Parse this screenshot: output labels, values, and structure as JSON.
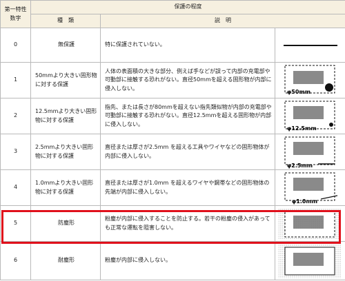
{
  "header": {
    "first_digit": "第一特性\n数字",
    "protection_degree": "保護の程度",
    "type": "種　類",
    "description": "説　明"
  },
  "rows": [
    {
      "digit": "0",
      "type": "無保護",
      "description": "特に保護されていない。",
      "figure": "line"
    },
    {
      "digit": "1",
      "type": "50mmより大きい固形物に対する保護",
      "description": "人体の表面積の大きな部分、例えば手などが誤って内部の充電部や可動部に接触する恐れがない。直径50mmを超える固形物が内部に侵入しない。",
      "figure": "50mm"
    },
    {
      "digit": "2",
      "type": "12.5mmより大きい固形物に対する保護",
      "description": "指先、または長さが80mmを超えない指先類似物が内部の充電部や可動部に接触する恐れがない。直径12.5mmを超える固形物が内部に侵入しない。",
      "figure": "12.5mm"
    },
    {
      "digit": "3",
      "type": "2.5mmより大きい固形物に対する保護",
      "description": "直径または厚さが2.5mm を超える工具やワイヤなどの固形物体が内部に侵入しない。",
      "figure": "2.5mm"
    },
    {
      "digit": "4",
      "type": "1.0mmより大きい固形物に対する保護",
      "description": "直径または厚さが1.0mm を超えるワイヤや鋼帯などの固形物体の先端が内部に侵入しない。",
      "figure": "1.0mm"
    },
    {
      "digit": "5",
      "type": "防塵形",
      "description": "粉塵が内部に侵入することを防止する。若干の粉塵の侵入があっても正常な運転を阻害しない。",
      "figure": "dust"
    },
    {
      "digit": "6",
      "type": "耐塵形",
      "description": "粉塵が内部に侵入しない。",
      "figure": "dusttight"
    }
  ],
  "figure_labels": {
    "f1": "φ50mm",
    "f2": "φ12.5mm",
    "f3": "φ2.5mm",
    "f4": "φ1.0mm"
  },
  "colors": {
    "header_bg": "#f6f0e0",
    "highlight": "#e0101b",
    "grey_box": "#8a8a8a"
  }
}
